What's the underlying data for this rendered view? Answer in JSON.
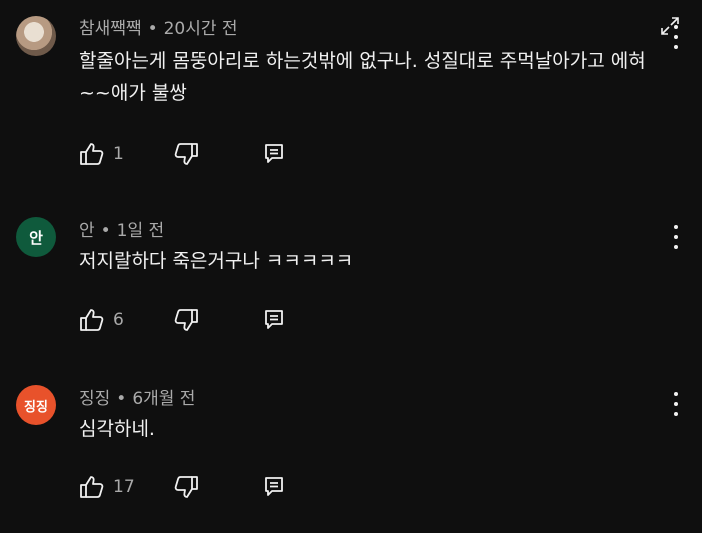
{
  "comments": [
    {
      "author": "참새짹짹",
      "separator": "•",
      "time": "20시간 전",
      "text": "할줄아는게 몸뚱아리로 하는것밖에 없구나. 성질대로 주먹날아가고 에혀~~애가 불쌍",
      "likes": "1",
      "avatar_type": "photo"
    },
    {
      "author": "안",
      "separator": "•",
      "time": "1일 전",
      "text": "저지랄하다 죽은거구나 ㅋㅋㅋㅋㅋ",
      "likes": "6",
      "avatar_letter": "안",
      "avatar_color": "#0f5a3c"
    },
    {
      "author": "징징",
      "separator": "•",
      "time": "6개월 전",
      "text": "심각하네.",
      "likes": "17",
      "avatar_letter": "징징",
      "avatar_color": "#e8522b"
    }
  ],
  "icons": {
    "like": "thumbs-up-icon",
    "dislike": "thumbs-down-icon",
    "reply": "reply-icon",
    "more": "more-vert-icon",
    "expand": "expand-icon"
  },
  "colors": {
    "background": "#0f0f0f",
    "primary_text": "#f1f1f1",
    "secondary_text": "#aaaaaa"
  }
}
